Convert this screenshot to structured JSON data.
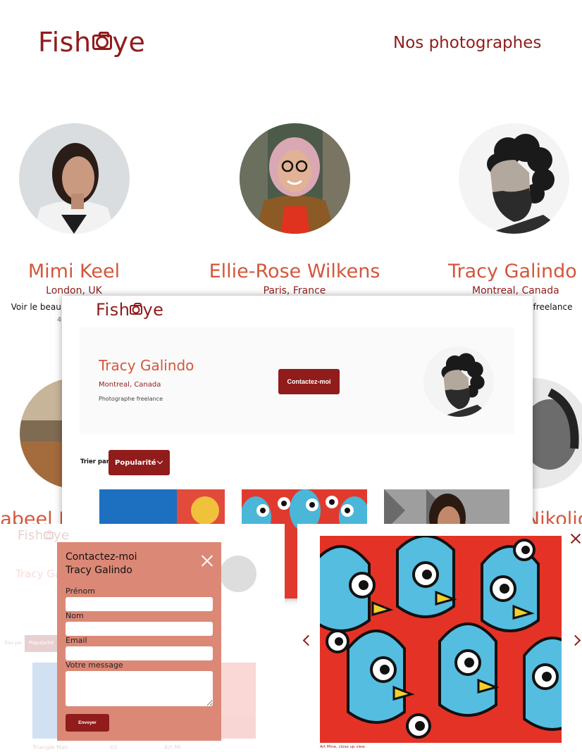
{
  "brand": {
    "logo_left": "Fish",
    "logo_right": "ye",
    "logo_icon": "camera-icon",
    "primary": "#901c1c",
    "accent": "#d3573c",
    "modal_bg": "#db8876"
  },
  "home": {
    "nav_title": "Nos photographes",
    "photographers": [
      {
        "name": "Mimi Keel",
        "location": "London, UK",
        "tagline": "Voir le beau dans le quotidien",
        "price": "400€/jour"
      },
      {
        "name": "Ellie-Rose Wilkens",
        "location": "Paris, France",
        "tagline": "",
        "price": ""
      },
      {
        "name": "Tracy Galindo",
        "location": "Montreal, Canada",
        "tagline": "Photographe freelance",
        "price": ""
      },
      {
        "name": "Nabeel Bradford",
        "location": "",
        "tagline": "",
        "price": ""
      },
      {
        "name": "Marcel Nikolic",
        "location": "",
        "tagline": "",
        "price": ""
      }
    ]
  },
  "photographer_page": {
    "name": "Tracy Galindo",
    "location": "Montreal, Canada",
    "tagline": "Photographe freelance",
    "contact_label": "Contactez-moi",
    "sort_label": "Trier par",
    "sort_value": "Popularité"
  },
  "contact_modal": {
    "title": "Contactez-moi\nTracy Galindo",
    "first_name_label": "Prénom",
    "last_name_label": "Nom",
    "email_label": "Email",
    "message_label": "Votre message",
    "send_label": "Envoyer",
    "bg_header_name": "Tracy Ga",
    "bg_sort_label": "Trier par",
    "bg_sort_value": "Popularité",
    "bg_media_title_1": "Triangle Man",
    "bg_media_likes_1": "60",
    "bg_media_title_2": "Art Mi"
  },
  "lightbox": {
    "caption": "Art Mine, close up view"
  }
}
